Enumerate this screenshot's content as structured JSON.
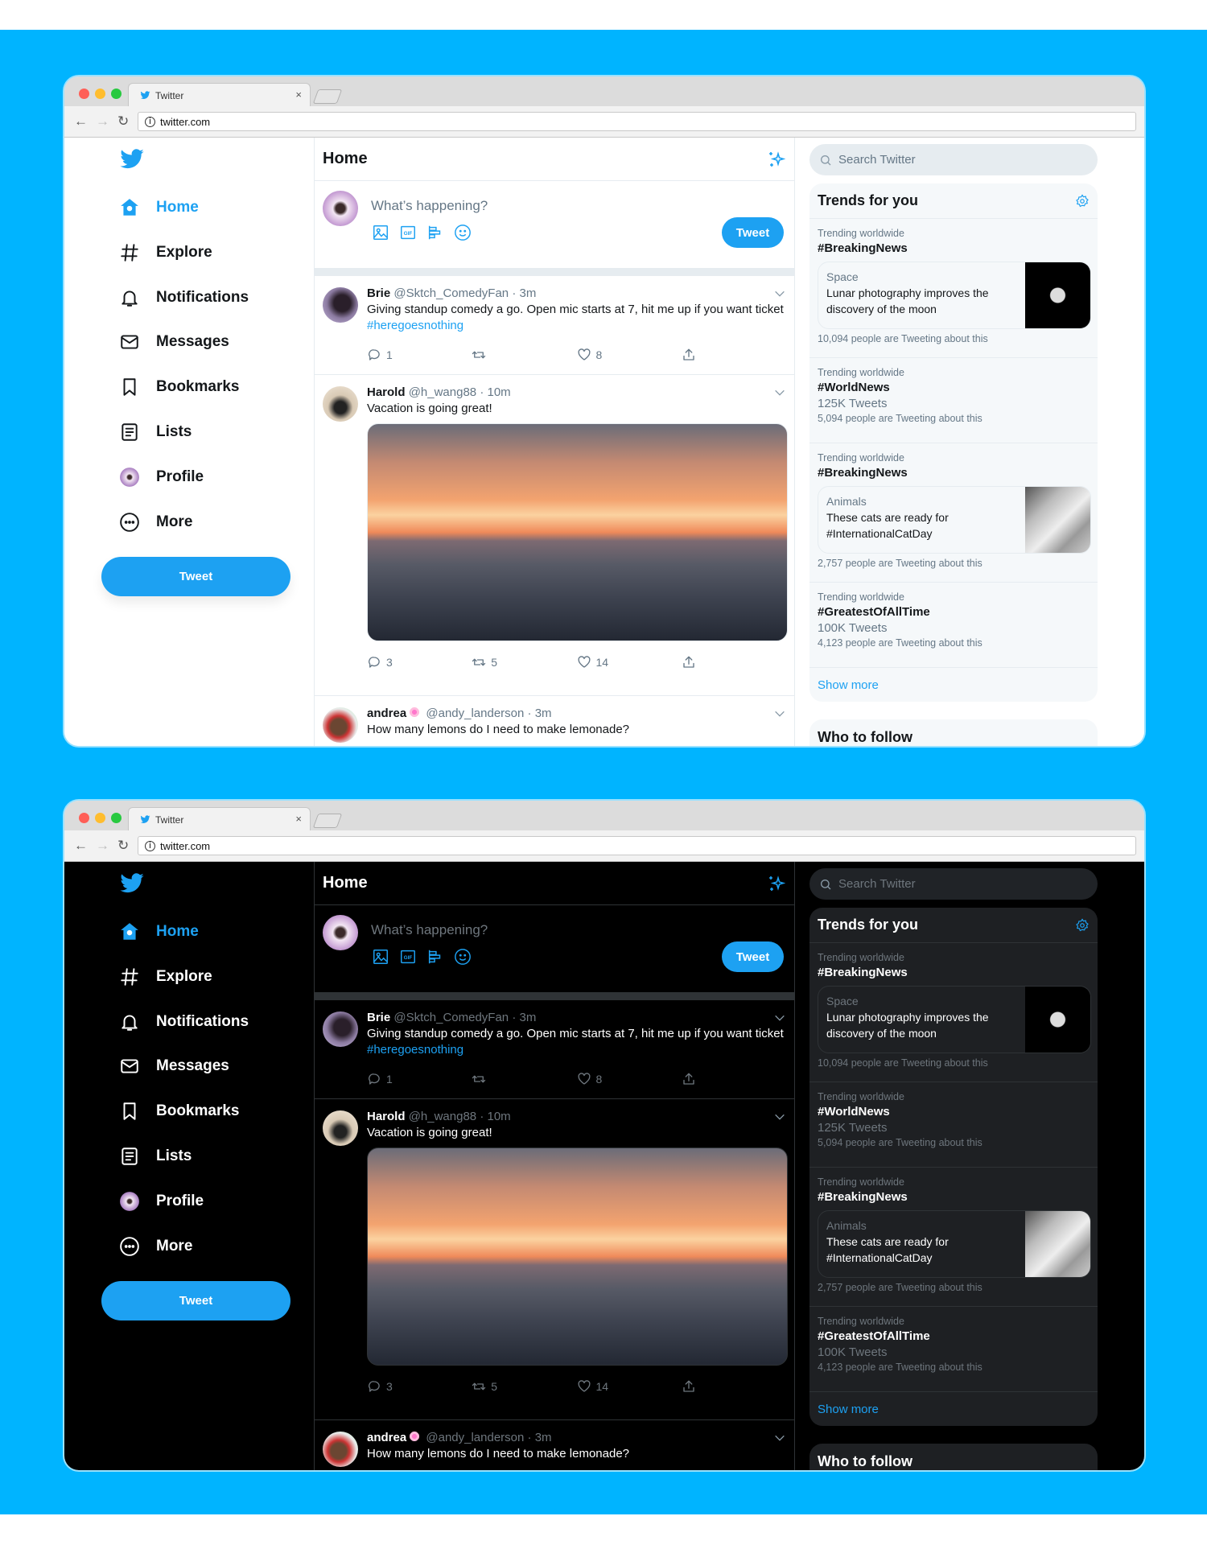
{
  "colors": {
    "background": "#00b4ff",
    "accent": "#1da1f2",
    "light_theme_bg": "#ffffff",
    "dark_theme_bg": "#000000"
  },
  "browser": {
    "tab_title": "Twitter",
    "url": "twitter.com"
  },
  "sidebar": {
    "items": [
      {
        "label": "Home",
        "icon": "home-icon",
        "active": true
      },
      {
        "label": "Explore",
        "icon": "hashtag-icon"
      },
      {
        "label": "Notifications",
        "icon": "bell-icon"
      },
      {
        "label": "Messages",
        "icon": "envelope-icon"
      },
      {
        "label": "Bookmarks",
        "icon": "bookmark-icon"
      },
      {
        "label": "Lists",
        "icon": "list-icon"
      },
      {
        "label": "Profile",
        "icon": "profile-avatar-icon"
      },
      {
        "label": "More",
        "icon": "more-icon"
      }
    ],
    "tweet_button": "Tweet"
  },
  "header": {
    "title": "Home",
    "icon": "sparkle-icon"
  },
  "compose": {
    "placeholder": "What’s happening?",
    "tweet_button": "Tweet",
    "tools": [
      "image-icon",
      "gif-icon",
      "poll-icon",
      "emoji-icon"
    ]
  },
  "tweets": [
    {
      "name": "Brie",
      "handle": "@Sktch_ComedyFan",
      "time": "3m",
      "text": "Giving standup comedy a go. Open mic starts at 7, hit me up if you want ticket ",
      "hashtag": "#heregoesnothing",
      "replies": "1",
      "retweets": "",
      "likes": "8",
      "avatar": "brie"
    },
    {
      "name": "Harold",
      "handle": "@h_wang88",
      "time": "10m",
      "text": "Vacation is going great!",
      "hashtag": "",
      "replies": "3",
      "retweets": "5",
      "likes": "14",
      "image": "sunset-photo",
      "avatar": "harold"
    },
    {
      "name": "andrea",
      "badge": "flower-emoji-icon",
      "handle": "@andy_landerson",
      "time": "3m",
      "text": "How many lemons do I need to make lemonade?",
      "hashtag": "",
      "avatar": "andrea"
    }
  ],
  "search": {
    "placeholder": "Search Twitter"
  },
  "trends": {
    "title": "Trends for you",
    "items": [
      {
        "label": "Trending worldwide",
        "tag": "#BreakingNews",
        "card": {
          "category": "Space",
          "headline": "Lunar photography improves the discovery of the moon",
          "image": "moon"
        },
        "people": "10,094 people are Tweeting about this"
      },
      {
        "label": "Trending worldwide",
        "tag": "#WorldNews",
        "count": "125K Tweets",
        "people": "5,094 people are Tweeting about this"
      },
      {
        "label": "Trending worldwide",
        "tag": "#BreakingNews",
        "card": {
          "category": "Animals",
          "headline": "These cats are ready for #InternationalCatDay",
          "image": "cat"
        },
        "people": "2,757 people are Tweeting about this"
      },
      {
        "label": "Trending worldwide",
        "tag": "#GreatestOfAllTime",
        "count": "100K Tweets",
        "people": "4,123 people are Tweeting about this"
      }
    ],
    "show_more": "Show more"
  },
  "who_to_follow": {
    "title": "Who to follow"
  },
  "themes": [
    "light",
    "dark"
  ]
}
